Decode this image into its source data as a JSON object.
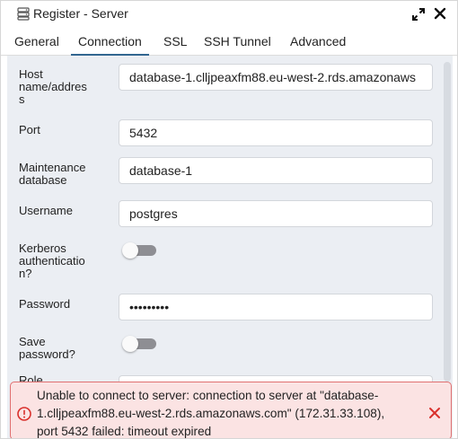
{
  "window": {
    "title": "Register - Server",
    "icons": {
      "title": "server-icon",
      "maximize": "maximize-icon",
      "close": "close-icon"
    }
  },
  "tabs": [
    {
      "label": "General",
      "active": false
    },
    {
      "label": "Connection",
      "active": true
    },
    {
      "label": "SSL",
      "active": false
    },
    {
      "label": "SSH Tunnel",
      "active": false
    },
    {
      "label": "Advanced",
      "active": false
    }
  ],
  "form": {
    "host": {
      "label_lines": [
        "Host",
        "name/addres",
        "s"
      ],
      "value": "database-1.clljpeaxfm88.eu-west-2.rds.amazonaws"
    },
    "port": {
      "label": "Port",
      "value": "5432"
    },
    "maintenance_db": {
      "label_lines": [
        "Maintenance",
        "database"
      ],
      "value": "database-1"
    },
    "username": {
      "label": "Username",
      "value": "postgres"
    },
    "kerberos": {
      "label_lines": [
        "Kerberos",
        "authenticatio",
        "n?"
      ],
      "enabled": false
    },
    "password": {
      "label": "Password",
      "value": "•••••••••"
    },
    "save_password": {
      "label_lines": [
        "Save",
        "password?"
      ],
      "enabled": false
    },
    "partial_label": "Role"
  },
  "error": {
    "lines": [
      "Unable to connect to server: connection to server at \"database-",
      "1.clljpeaxfm88.eu-west-2.rds.amazonaws.com\" (172.31.33.108),",
      "port 5432 failed: timeout expired"
    ],
    "icon": "error-circle-icon",
    "dismiss_icon": "close-icon"
  },
  "colors": {
    "accent": "#326690",
    "error_bg": "#fbe3e3",
    "error_border": "#e07070",
    "error_icon": "#d9302c",
    "panel_bg": "#ebeef3"
  }
}
